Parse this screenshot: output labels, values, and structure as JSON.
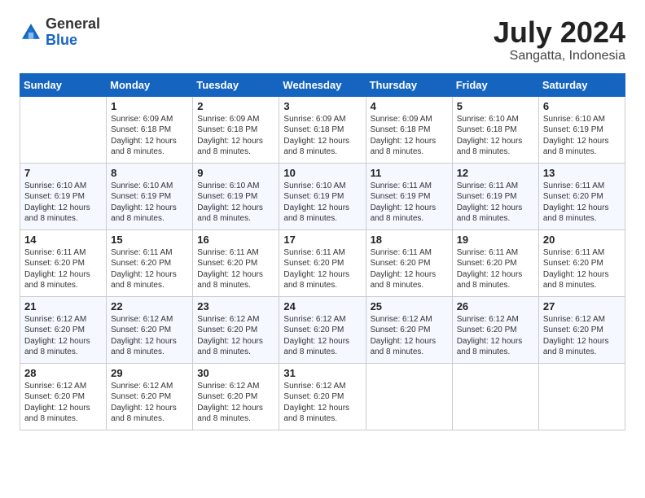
{
  "logo": {
    "general": "General",
    "blue": "Blue"
  },
  "title": "July 2024",
  "location": "Sangatta, Indonesia",
  "weekdays": [
    "Sunday",
    "Monday",
    "Tuesday",
    "Wednesday",
    "Thursday",
    "Friday",
    "Saturday"
  ],
  "weeks": [
    [
      {
        "day": "",
        "info": ""
      },
      {
        "day": "1",
        "info": "Sunrise: 6:09 AM\nSunset: 6:18 PM\nDaylight: 12 hours\nand 8 minutes."
      },
      {
        "day": "2",
        "info": "Sunrise: 6:09 AM\nSunset: 6:18 PM\nDaylight: 12 hours\nand 8 minutes."
      },
      {
        "day": "3",
        "info": "Sunrise: 6:09 AM\nSunset: 6:18 PM\nDaylight: 12 hours\nand 8 minutes."
      },
      {
        "day": "4",
        "info": "Sunrise: 6:09 AM\nSunset: 6:18 PM\nDaylight: 12 hours\nand 8 minutes."
      },
      {
        "day": "5",
        "info": "Sunrise: 6:10 AM\nSunset: 6:18 PM\nDaylight: 12 hours\nand 8 minutes."
      },
      {
        "day": "6",
        "info": "Sunrise: 6:10 AM\nSunset: 6:19 PM\nDaylight: 12 hours\nand 8 minutes."
      }
    ],
    [
      {
        "day": "7",
        "info": "Sunrise: 6:10 AM\nSunset: 6:19 PM\nDaylight: 12 hours\nand 8 minutes."
      },
      {
        "day": "8",
        "info": "Sunrise: 6:10 AM\nSunset: 6:19 PM\nDaylight: 12 hours\nand 8 minutes."
      },
      {
        "day": "9",
        "info": "Sunrise: 6:10 AM\nSunset: 6:19 PM\nDaylight: 12 hours\nand 8 minutes."
      },
      {
        "day": "10",
        "info": "Sunrise: 6:10 AM\nSunset: 6:19 PM\nDaylight: 12 hours\nand 8 minutes."
      },
      {
        "day": "11",
        "info": "Sunrise: 6:11 AM\nSunset: 6:19 PM\nDaylight: 12 hours\nand 8 minutes."
      },
      {
        "day": "12",
        "info": "Sunrise: 6:11 AM\nSunset: 6:19 PM\nDaylight: 12 hours\nand 8 minutes."
      },
      {
        "day": "13",
        "info": "Sunrise: 6:11 AM\nSunset: 6:20 PM\nDaylight: 12 hours\nand 8 minutes."
      }
    ],
    [
      {
        "day": "14",
        "info": "Sunrise: 6:11 AM\nSunset: 6:20 PM\nDaylight: 12 hours\nand 8 minutes."
      },
      {
        "day": "15",
        "info": "Sunrise: 6:11 AM\nSunset: 6:20 PM\nDaylight: 12 hours\nand 8 minutes."
      },
      {
        "day": "16",
        "info": "Sunrise: 6:11 AM\nSunset: 6:20 PM\nDaylight: 12 hours\nand 8 minutes."
      },
      {
        "day": "17",
        "info": "Sunrise: 6:11 AM\nSunset: 6:20 PM\nDaylight: 12 hours\nand 8 minutes."
      },
      {
        "day": "18",
        "info": "Sunrise: 6:11 AM\nSunset: 6:20 PM\nDaylight: 12 hours\nand 8 minutes."
      },
      {
        "day": "19",
        "info": "Sunrise: 6:11 AM\nSunset: 6:20 PM\nDaylight: 12 hours\nand 8 minutes."
      },
      {
        "day": "20",
        "info": "Sunrise: 6:11 AM\nSunset: 6:20 PM\nDaylight: 12 hours\nand 8 minutes."
      }
    ],
    [
      {
        "day": "21",
        "info": "Sunrise: 6:12 AM\nSunset: 6:20 PM\nDaylight: 12 hours\nand 8 minutes."
      },
      {
        "day": "22",
        "info": "Sunrise: 6:12 AM\nSunset: 6:20 PM\nDaylight: 12 hours\nand 8 minutes."
      },
      {
        "day": "23",
        "info": "Sunrise: 6:12 AM\nSunset: 6:20 PM\nDaylight: 12 hours\nand 8 minutes."
      },
      {
        "day": "24",
        "info": "Sunrise: 6:12 AM\nSunset: 6:20 PM\nDaylight: 12 hours\nand 8 minutes."
      },
      {
        "day": "25",
        "info": "Sunrise: 6:12 AM\nSunset: 6:20 PM\nDaylight: 12 hours\nand 8 minutes."
      },
      {
        "day": "26",
        "info": "Sunrise: 6:12 AM\nSunset: 6:20 PM\nDaylight: 12 hours\nand 8 minutes."
      },
      {
        "day": "27",
        "info": "Sunrise: 6:12 AM\nSunset: 6:20 PM\nDaylight: 12 hours\nand 8 minutes."
      }
    ],
    [
      {
        "day": "28",
        "info": "Sunrise: 6:12 AM\nSunset: 6:20 PM\nDaylight: 12 hours\nand 8 minutes."
      },
      {
        "day": "29",
        "info": "Sunrise: 6:12 AM\nSunset: 6:20 PM\nDaylight: 12 hours\nand 8 minutes."
      },
      {
        "day": "30",
        "info": "Sunrise: 6:12 AM\nSunset: 6:20 PM\nDaylight: 12 hours\nand 8 minutes."
      },
      {
        "day": "31",
        "info": "Sunrise: 6:12 AM\nSunset: 6:20 PM\nDaylight: 12 hours\nand 8 minutes."
      },
      {
        "day": "",
        "info": ""
      },
      {
        "day": "",
        "info": ""
      },
      {
        "day": "",
        "info": ""
      }
    ]
  ]
}
